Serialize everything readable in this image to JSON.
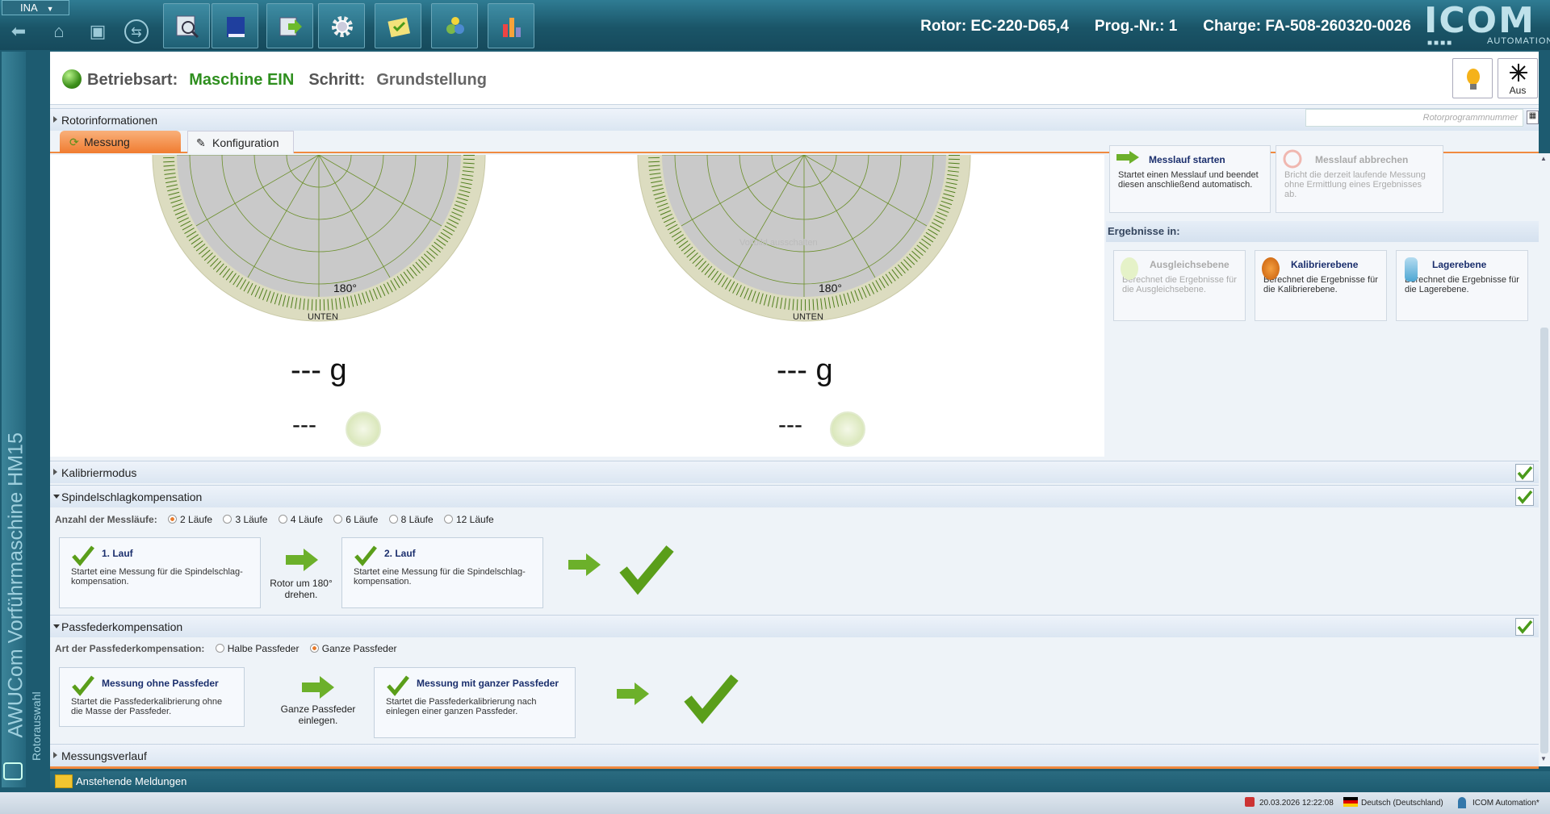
{
  "app": {
    "ina_label": "INA",
    "brand_top": "ICOM",
    "brand_sub": "AUTOMATION",
    "side_title": "AWUCom Vorführmaschine HM15",
    "side_sub": "Rotorauswahl"
  },
  "top": {
    "rotor": "Rotor:  EC-220-D65,4",
    "prog": "Prog.-Nr.:  1",
    "charge": "Charge: FA-508-260320-0026"
  },
  "mode": {
    "label": "Betriebsart:",
    "value": "Maschine EIN",
    "step_label": "Schritt:",
    "step_value": "Grundstellung",
    "laser_label": "Aus"
  },
  "sections": {
    "rotorinfo": "Rotorinformationen",
    "search_placeholder": "Rotorprogrammnummer",
    "kalib": "Kalibriermodus",
    "spindel": "Spindelschlagkompensation",
    "pass": "Passfederkompensation",
    "verlauf": "Messungsverlauf"
  },
  "tabs": {
    "measure": "Messung",
    "config": "Konfiguration"
  },
  "dial": {
    "left_angle": "180°",
    "left_bottom": "UNTEN",
    "right_angle": "180°",
    "right_bottom": "UNTEN",
    "watermark": "Vollbild ausschalten"
  },
  "readout": {
    "left_weight": "--- g",
    "left_phase": "---",
    "right_weight": "--- g",
    "right_phase": "---"
  },
  "actions": {
    "start_title": "Messlauf starten",
    "start_text": "Startet einen Messlauf und beendet diesen anschließend automatisch.",
    "abort_title": "Messlauf abbrechen",
    "abort_text": "Bricht die derzeit laufende Messung ohne Ermittlung eines Ergebnisses ab."
  },
  "results": {
    "title": "Ergebnisse in:",
    "ausgleich_title": "Ausgleichsebene",
    "ausgleich_text": "Berechnet die Ergebnisse für die Ausgleichsebene.",
    "kalib_title": "Kalibrierebene",
    "kalib_text": "Berechnet die Ergebnisse für die Kalibrierebene.",
    "lager_title": "Lagerebene",
    "lager_text": "Berechnet die Ergebnisse für die Lagerebene."
  },
  "spindel": {
    "count_label": "Anzahl der Messläufe:",
    "options": [
      "2 Läufe",
      "3 Läufe",
      "4 Läufe",
      "6 Läufe",
      "8 Läufe",
      "12 Läufe"
    ],
    "run1_title": "1. Lauf",
    "run1_text": "Startet eine Messung für die Spindelschlag-kompensation.",
    "rotate_text": "Rotor um 180° drehen.",
    "run2_title": "2. Lauf",
    "run2_text": "Startet eine Messung für die Spindelschlag-kompensation."
  },
  "pass": {
    "type_label": "Art der Passfederkompensation:",
    "opt_half": "Halbe Passfeder",
    "opt_full": "Ganze Passfeder",
    "run1_title": "Messung ohne Passfeder",
    "run1_text": "Startet die Passfederkalibrierung ohne die Masse der Passfeder.",
    "insert_text": "Ganze Passfeder einlegen.",
    "run2_title": "Messung mit ganzer Passfeder",
    "run2_text": "Startet die Passfederkalibrierung nach einlegen einer ganzen Passfeder."
  },
  "status": {
    "messages": "Anstehende Meldungen",
    "datetime": "20.03.2026 12:22:08",
    "language": "Deutsch (Deutschland)",
    "user": "ICOM Automation*"
  },
  "colors": {
    "accent_orange": "#f08a40",
    "mode_green": "#2f8f1f",
    "check_green": "#5a9e1a"
  }
}
